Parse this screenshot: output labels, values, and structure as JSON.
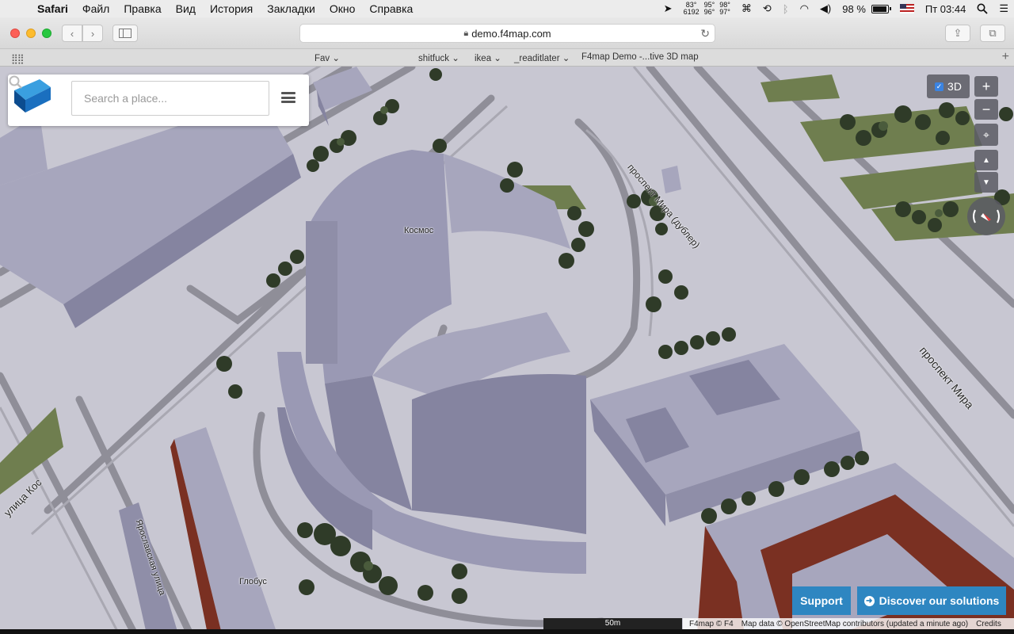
{
  "menubar": {
    "app": "Safari",
    "items": [
      "Файл",
      "Правка",
      "Вид",
      "История",
      "Закладки",
      "Окно",
      "Справка"
    ],
    "temps": [
      [
        "83°",
        "6192"
      ],
      [
        "95°",
        "96°"
      ],
      [
        "98°",
        "97°"
      ]
    ],
    "battery": "98 %",
    "clock": "Пт 03:44"
  },
  "browser": {
    "url": "demo.f4map.com",
    "bookmarks": [
      "Fav",
      "shitfuck",
      "ikea",
      "_readitlater",
      "F4map Demo -...tive 3D map"
    ]
  },
  "map": {
    "search_placeholder": "Search a place...",
    "toggle_3d_label": "3D",
    "zoom_in": "+",
    "zoom_out": "−",
    "labels": {
      "kosmos": "Космос",
      "globus": "Глобус",
      "prospekt_mira_dubler": "проспект Мира (дублер)",
      "prospekt_mira": "проспект Мира",
      "ulitsa_kos": "улица Кос",
      "yaroslavskaya": "Ярославская улица"
    },
    "support_label": "Support",
    "discover_label": "Discover our solutions",
    "scale_label": "50m",
    "attribution": {
      "brand": "F4map © F4",
      "data": "Map data © OpenStreetMap contributors (updated a minute ago)",
      "credits": "Credits"
    },
    "colors": {
      "building": "#9a99b4",
      "ground": "#c8c7d2",
      "road": "#8f8e98",
      "grass": "#6f7e4f",
      "brick": "#7a3022",
      "accent": "#2e86c1"
    }
  }
}
